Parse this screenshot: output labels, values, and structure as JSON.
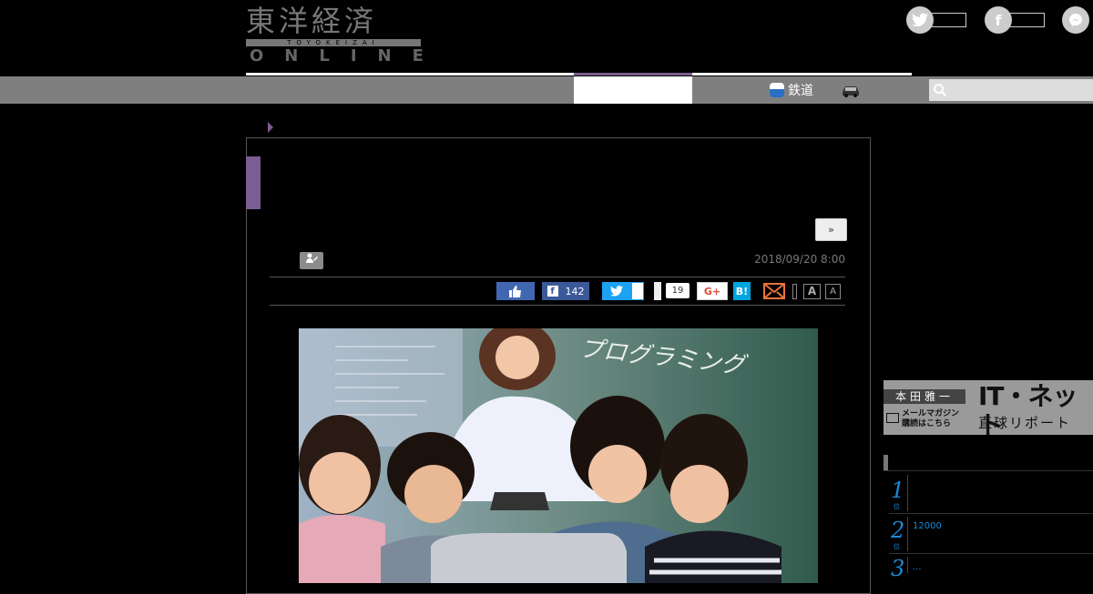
{
  "brand": {
    "logo_kanji": "東洋経済",
    "logo_romaji": "TOYOKEIZAI",
    "logo_online": "ONLINE"
  },
  "header": {
    "social_icons": [
      "twitter-icon",
      "facebook-icon",
      "messenger-icon"
    ]
  },
  "nav": {
    "items": [
      {
        "label": "鉄道",
        "icon": "railway-icon"
      },
      {
        "label": "",
        "icon": "car-icon"
      }
    ]
  },
  "article": {
    "next_label": "»",
    "date": "2018/09/20 8:00",
    "share": {
      "facebook_count": "142",
      "pocket_count": "19",
      "gplus_label": "G+",
      "hatena_label": "B!",
      "font_large_label": "A",
      "font_small_label": "A"
    },
    "photo_chalk_text": "プログラミング"
  },
  "sidebar": {
    "banner": {
      "name": "本田雅一",
      "mail_line1": "メールマガジン",
      "mail_line2": "購読はこちら",
      "title": "IT・ネット",
      "subtitle": "直球リポート"
    },
    "ranking": [
      {
        "rank": "1",
        "suffix": "位",
        "text": ""
      },
      {
        "rank": "2",
        "suffix": "位",
        "text": "12000"
      },
      {
        "rank": "3",
        "suffix": "位",
        "text": "..."
      }
    ]
  },
  "colors": {
    "accent": "#7a5d91",
    "nav_bg": "#7f7f7f",
    "facebook": "#3b5998",
    "twitter": "#1da1f2",
    "hatena": "#00a4de",
    "rank_blue": "#1c8ad8"
  }
}
